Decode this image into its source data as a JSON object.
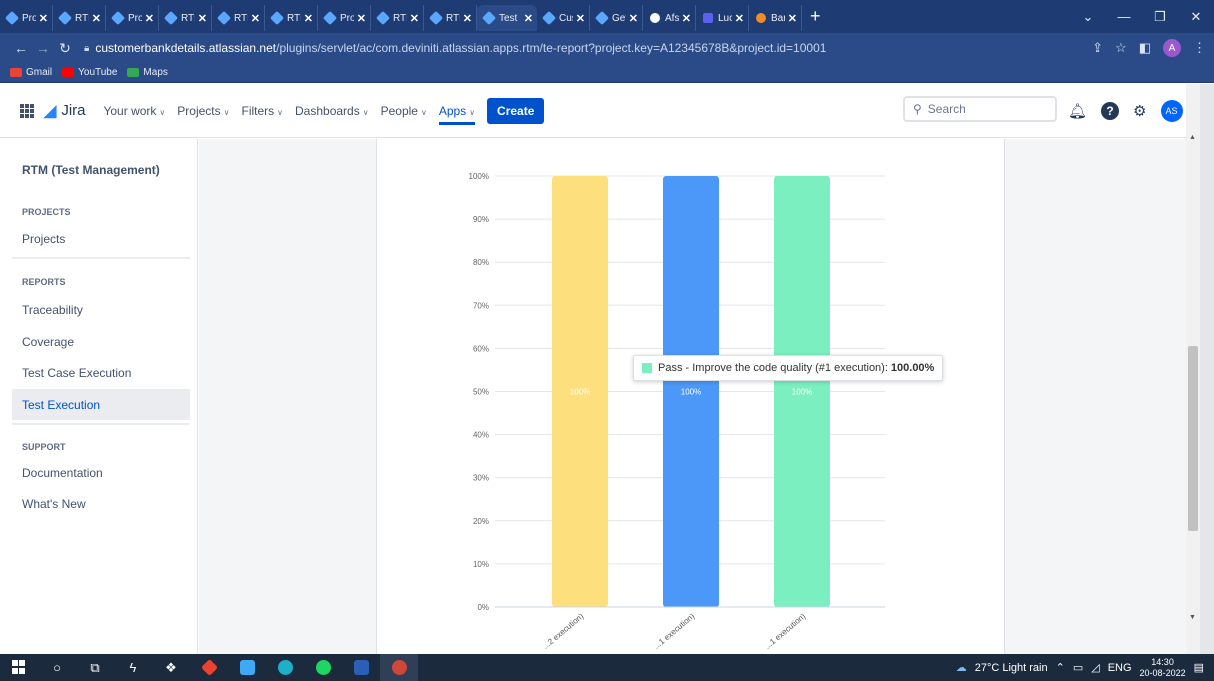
{
  "browser": {
    "tabs": [
      {
        "label": "Proj",
        "icon": "jira-icon"
      },
      {
        "label": "RTM",
        "icon": "jira-icon"
      },
      {
        "label": "Proj",
        "icon": "jira-icon"
      },
      {
        "label": "RTM",
        "icon": "jira-icon"
      },
      {
        "label": "RTM",
        "icon": "jira-icon"
      },
      {
        "label": "RTM",
        "icon": "jira-icon"
      },
      {
        "label": "Proj",
        "icon": "jira-icon"
      },
      {
        "label": "RTM",
        "icon": "jira-icon"
      },
      {
        "label": "RTM",
        "icon": "jira-icon"
      },
      {
        "label": "Test",
        "icon": "jira-icon",
        "active": true
      },
      {
        "label": "Cus",
        "icon": "jira-icon"
      },
      {
        "label": "Get",
        "icon": "jira-icon"
      },
      {
        "label": "Afs",
        "icon": "github-icon"
      },
      {
        "label": "Luc",
        "icon": "lucid-icon"
      },
      {
        "label": "Ban",
        "icon": "bank-icon"
      }
    ],
    "close_glyph": "✕",
    "new_tab": "+",
    "url_host": "customerbankdetails.atlassian.net",
    "url_path": "/plugins/servlet/ac/com.deviniti.atlassian.apps.rtm/te-report?project.key=A12345678B&project.id=10001",
    "profile_initial": "A",
    "bookmarks": [
      {
        "label": "Gmail",
        "color": "#ea4335"
      },
      {
        "label": "YouTube",
        "color": "#ff0000"
      },
      {
        "label": "Maps",
        "color": "#34a853"
      }
    ]
  },
  "jira": {
    "logo": "Jira",
    "nav": [
      {
        "label": "Your work"
      },
      {
        "label": "Projects"
      },
      {
        "label": "Filters"
      },
      {
        "label": "Dashboards"
      },
      {
        "label": "People"
      },
      {
        "label": "Apps",
        "active": true
      }
    ],
    "create_label": "Create",
    "search_placeholder": "Search",
    "avatar_initials": "AS"
  },
  "sidebar": {
    "title": "RTM (Test Management)",
    "projects_heading": "PROJECTS",
    "projects_item": "Projects",
    "reports_heading": "REPORTS",
    "reports_items": [
      "Traceability",
      "Coverage",
      "Test Case Execution",
      "Test Execution"
    ],
    "active_item": "Test Execution",
    "support_heading": "SUPPORT",
    "support_items": [
      "Documentation",
      "What's New"
    ]
  },
  "chart_data": {
    "type": "bar",
    "y_ticks": [
      "100%",
      "90%",
      "80%",
      "70%",
      "60%",
      "50%",
      "40%",
      "30%",
      "20%",
      "10%",
      "0%"
    ],
    "ylim": [
      0,
      100
    ],
    "categories": [
      "...2 execution)",
      "...1 execution)",
      "...1 execution)"
    ],
    "values": [
      100,
      100,
      100
    ],
    "bar_labels": [
      "100%",
      "100%",
      "100%"
    ],
    "colors": [
      "#fedf7d",
      "#4c98f8",
      "#7befbf"
    ],
    "tooltip": {
      "text": "Pass - Improve the code quality (#1 execution):",
      "value": "100.00%",
      "color": "#7befbf"
    }
  },
  "taskbar": {
    "weather": "27°C  Light rain",
    "language": "ENG",
    "time": "14:30",
    "date": "20-08-2022"
  }
}
